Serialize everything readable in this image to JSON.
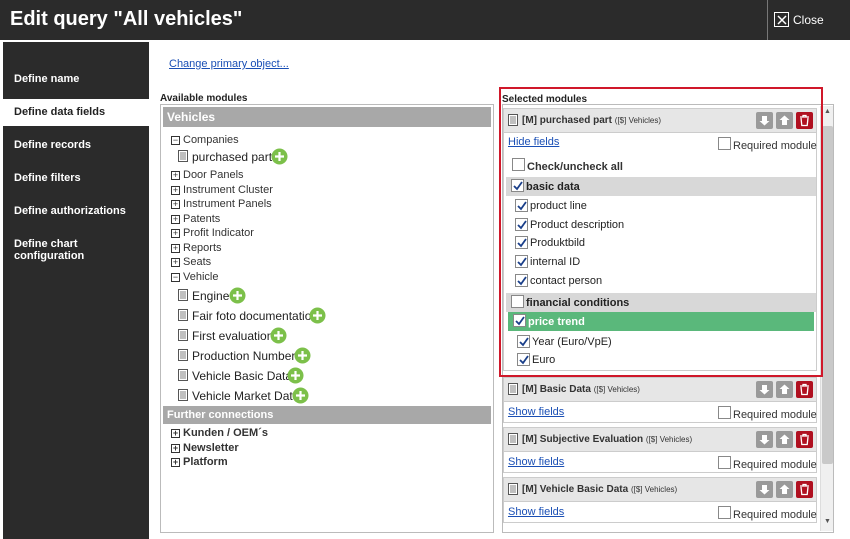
{
  "header": {
    "title": "Edit query \"All vehicles\"",
    "close_label": "Close"
  },
  "sidebar": {
    "items": [
      {
        "label": "Define name"
      },
      {
        "label": "Define data fields"
      },
      {
        "label": "Define records"
      },
      {
        "label": "Define filters"
      },
      {
        "label": "Define authorizations"
      },
      {
        "label": "Define chart configuration"
      }
    ],
    "active_index": 1
  },
  "main": {
    "change_primary_link": "Change primary object...",
    "available_label": "Available modules",
    "selected_label": "Selected modules"
  },
  "available": {
    "header": "Vehicles",
    "tree": [
      {
        "label": "Companies",
        "expanded": true
      },
      {
        "label": "Door Panels",
        "expanded": false
      },
      {
        "label": "Instrument Cluster",
        "expanded": false
      },
      {
        "label": "Instrument Panels",
        "expanded": false
      },
      {
        "label": "Patents",
        "expanded": false
      },
      {
        "label": "Profit Indicator",
        "expanded": false
      },
      {
        "label": "Reports",
        "expanded": false
      },
      {
        "label": "Seats",
        "expanded": false
      },
      {
        "label": "Vehicle",
        "expanded": true
      }
    ],
    "companies_modules": [
      "purchased part"
    ],
    "vehicle_modules": [
      "Engine",
      "Fair foto documentation",
      "First evaluation",
      "Production Numbers",
      "Vehicle Basic Data",
      "Vehicle Market Data"
    ],
    "further_header": "Further connections",
    "further": [
      "Kunden / OEM´s",
      "Newsletter",
      "Platform"
    ]
  },
  "selected": {
    "cards": [
      {
        "title": "[M] purchased part",
        "sub": "([$] Vehicles)",
        "fields_link": "Hide fields",
        "required_label": "Required module",
        "check_all": "Check/uncheck all",
        "groups": [
          {
            "label": "basic data",
            "checked": true,
            "fields": [
              {
                "label": "product line",
                "checked": true
              },
              {
                "label": "Product description",
                "checked": true
              },
              {
                "label": "Produktbild",
                "checked": true
              },
              {
                "label": "internal ID",
                "checked": true
              },
              {
                "label": "contact person",
                "checked": true
              }
            ]
          },
          {
            "label": "financial conditions",
            "checked": false,
            "subgroup": {
              "label": "price trend",
              "checked": true,
              "fields": [
                {
                  "label": "Year (Euro/VpE)",
                  "checked": true
                },
                {
                  "label": "Euro",
                  "checked": true
                }
              ]
            }
          }
        ]
      },
      {
        "title": "[M] Basic Data",
        "sub": "([$] Vehicles)",
        "fields_link": "Show fields",
        "required_label": "Required module"
      },
      {
        "title": "[M] Subjective Evaluation",
        "sub": "([$] Vehicles)",
        "fields_link": "Show fields",
        "required_label": "Required module"
      },
      {
        "title": "[M] Vehicle Basic Data",
        "sub": "([$] Vehicles)",
        "fields_link": "Show fields",
        "required_label": "Required module"
      }
    ]
  },
  "colors": {
    "header_bg": "#2b2b2b",
    "add_green": "#7cc04a",
    "delete_red": "#b01020",
    "selected_group": "#5ab87b",
    "highlight": "#d0182a"
  },
  "icons": [
    "close-icon",
    "document-icon",
    "add-icon",
    "move-down-icon",
    "move-up-icon",
    "delete-icon",
    "plus-icon",
    "minus-icon",
    "checkbox-icon"
  ]
}
